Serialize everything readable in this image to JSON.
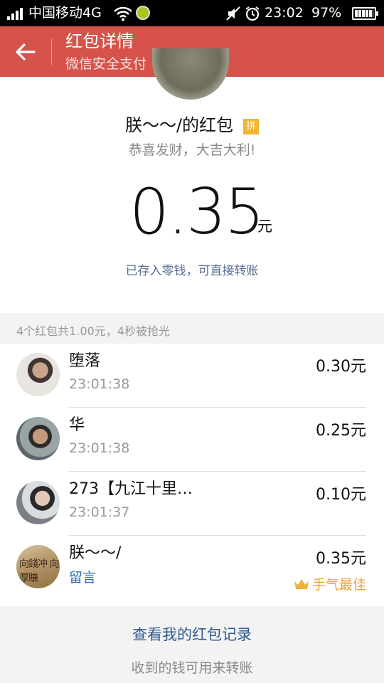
{
  "status_bar": {
    "carrier": "中国移动4G",
    "time": "23:02",
    "battery": "97%",
    "icons": [
      "signal-icon",
      "wifi-icon",
      "app-notification-icon",
      "mute-icon",
      "alarm-icon",
      "battery-icon"
    ]
  },
  "header": {
    "title": "红包详情",
    "subtitle": "微信安全支付",
    "background_color": "#d5534a"
  },
  "packet": {
    "sender_label": "朕～～/的红包",
    "pin_badge": "拼",
    "wish": "恭喜发财，大吉大利!",
    "amount": "0.35",
    "unit": "元",
    "saved_note": "已存入零钱，可直接转账"
  },
  "summary": "4个红包共1.00元，4秒被抢光",
  "recipients": [
    {
      "name": "堕落",
      "time": "23:01:38",
      "amount": "0.30元"
    },
    {
      "name": "华",
      "time": "23:01:38",
      "amount": "0.25元"
    },
    {
      "name": "273【九江十里…",
      "time": "23:01:37",
      "amount": "0.10元"
    },
    {
      "name": "朕～～/",
      "message_link": "留言",
      "amount": "0.35元",
      "best_luck": "手气最佳",
      "avatar_text": "向錢冲 向厚賺"
    }
  ],
  "footer": {
    "records_link": "查看我的红包记录",
    "note": "收到的钱可用来转账"
  },
  "colors": {
    "link_blue": "#576b95",
    "best_luck": "#e8a33a"
  }
}
